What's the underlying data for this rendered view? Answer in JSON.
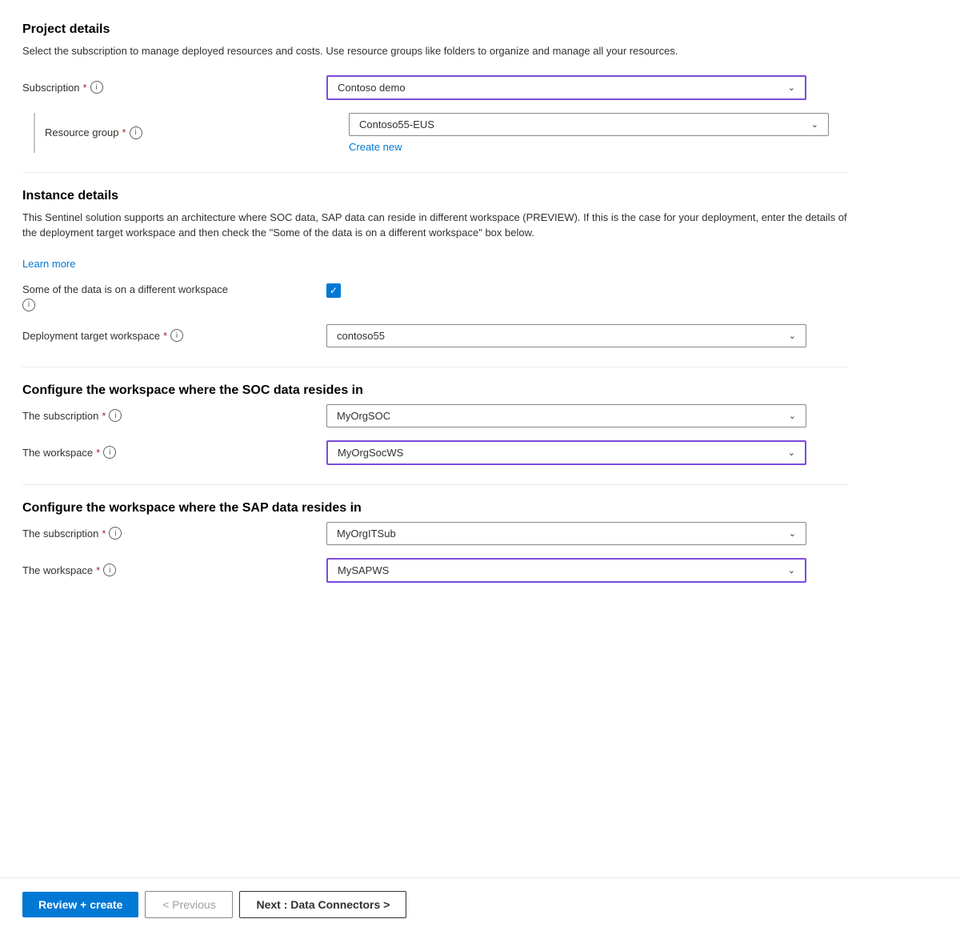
{
  "project_details": {
    "title": "Project details",
    "description": "Select the subscription to manage deployed resources and costs. Use resource groups like folders to organize and manage all your resources.",
    "subscription_label": "Subscription",
    "resource_group_label": "Resource group",
    "subscription_value": "Contoso demo",
    "resource_group_value": "Contoso55-EUS",
    "create_new_label": "Create new"
  },
  "instance_details": {
    "title": "Instance details",
    "description": "This Sentinel solution supports an architecture where SOC data, SAP data can reside in different workspace (PREVIEW). If this is the case for your deployment, enter the details of the deployment target workspace and then check the \"Some of the data is on a different workspace\" box below.",
    "learn_more_label": "Learn more",
    "different_workspace_label": "Some of the data is on a different workspace",
    "deployment_target_label": "Deployment target workspace",
    "deployment_target_value": "contoso55"
  },
  "soc_section": {
    "title": "Configure the workspace where the SOC data resides in",
    "subscription_label": "The subscription",
    "workspace_label": "The workspace",
    "subscription_value": "MyOrgSOC",
    "workspace_value": "MyOrgSocWS"
  },
  "sap_section": {
    "title": "Configure the workspace where the SAP data resides in",
    "subscription_label": "The subscription",
    "workspace_label": "The workspace",
    "subscription_value": "MyOrgITSub",
    "workspace_value": "MySAPWS"
  },
  "footer": {
    "review_create_label": "Review + create",
    "previous_label": "< Previous",
    "next_label": "Next : Data Connectors >"
  },
  "icons": {
    "info": "i",
    "chevron_down": "∨",
    "checkmark": "✓"
  }
}
